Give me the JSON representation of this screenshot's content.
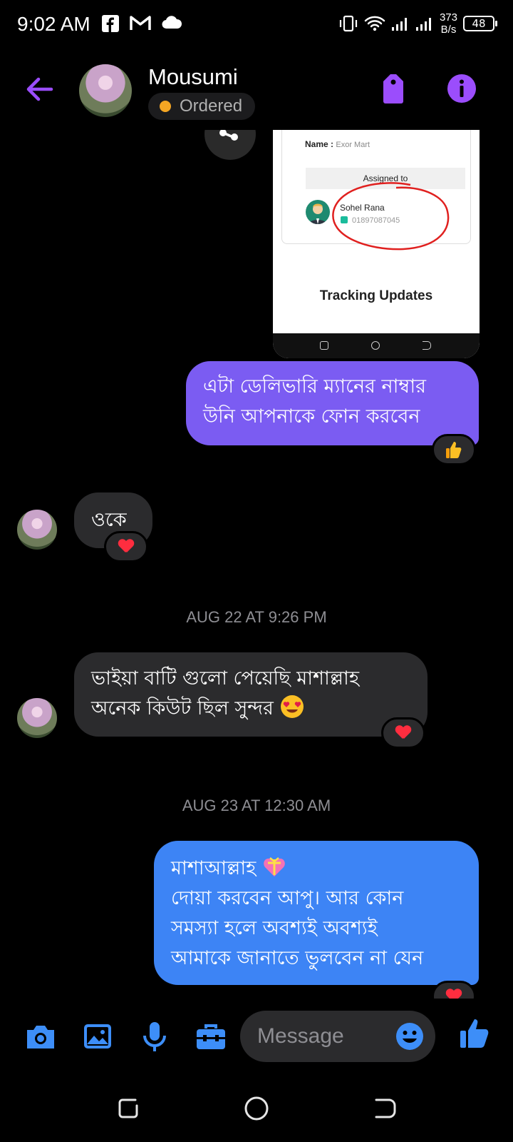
{
  "status_bar": {
    "time": "9:02 AM",
    "net_speed_value": "373",
    "net_speed_unit": "B/s",
    "battery": "48",
    "icons": [
      "facebook-icon",
      "gmail-icon",
      "cloud-icon",
      "vibrate-icon",
      "wifi-icon",
      "signal-icon",
      "signal-icon-2"
    ]
  },
  "header": {
    "contact_name": "Mousumi",
    "status": "Ordered",
    "status_color": "#f5a623",
    "accent_color": "#9b4dfc"
  },
  "conversation": {
    "shared_image": {
      "name_label": "Name :",
      "name_value": "Exor Mart",
      "assigned_to": "Assigned to",
      "person_name": "Sohel Rana",
      "person_phone": "01897087045",
      "tracking_title": "Tracking Updates"
    },
    "messages": [
      {
        "direction": "outgoing",
        "text_line1": "এটা ডেলিভারি ম্যানের নাম্বার",
        "text_line2": "উনি আপনাকে ফোন করবেন",
        "reaction": "thumbs-up",
        "color": "#7b5cf2"
      },
      {
        "direction": "incoming",
        "text": "ওকে",
        "reaction": "heart"
      },
      {
        "direction": "incoming",
        "text_line1": "ভাইয়া বাটি গুলো পেয়েছি মাশাল্লাহ",
        "text_line2": "অনেক কিউট ছিল সুন্দর",
        "emoji": "heart-eyes",
        "reaction": "heart"
      },
      {
        "direction": "outgoing",
        "text_line1": "মাশাআল্লাহ",
        "text_line1_emoji": "heart-with-ribbon",
        "text_line2": "দোয়া করবেন আপু। আর কোন",
        "text_line3": "সমস্যা হলে অবশ্যই অবশ্যই",
        "text_line4": "আমাকে জানাতে ভুলবেন না যেন",
        "reaction": "heart",
        "color": "#3d84f5"
      }
    ],
    "timestamps": [
      "AUG 22 AT 9:26 PM",
      "AUG 23 AT 12:30 AM"
    ]
  },
  "composer": {
    "placeholder": "Message",
    "accent_color": "#3d8ef8"
  }
}
